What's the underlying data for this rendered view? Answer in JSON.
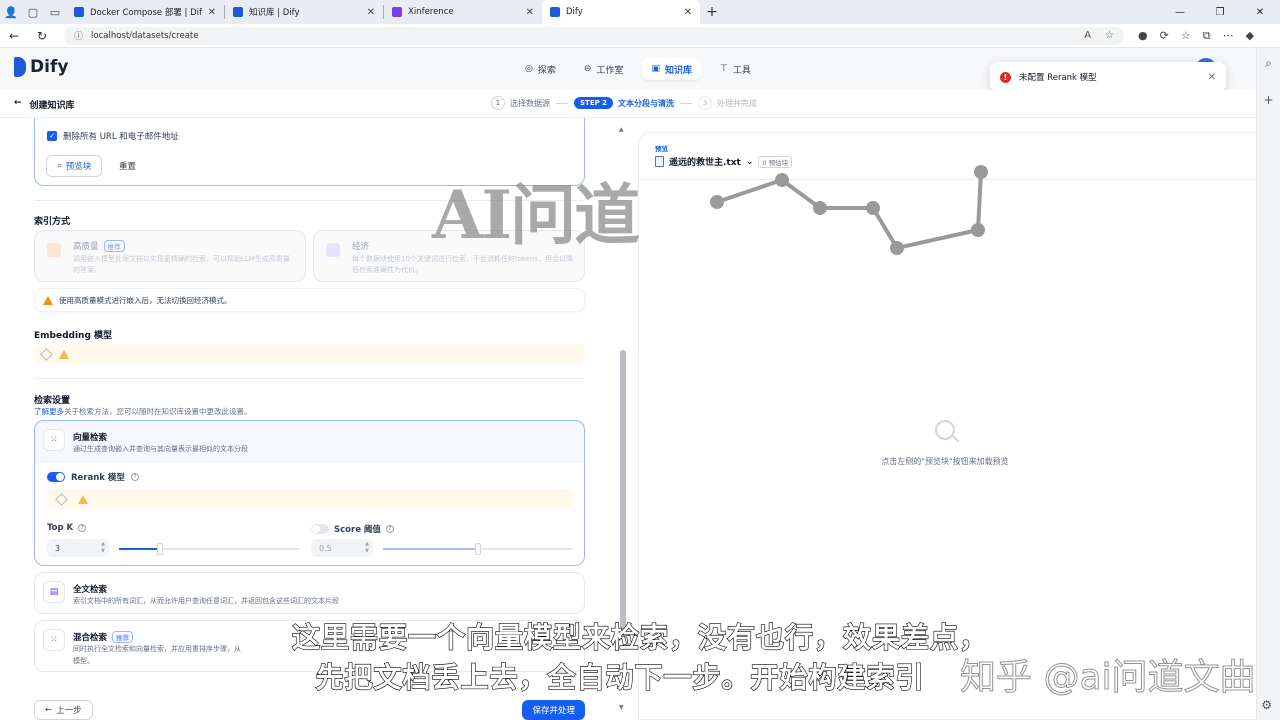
{
  "browser": {
    "tabs": [
      {
        "title": "Docker Compose 部署 | Dify",
        "fav": "#1f5bd8"
      },
      {
        "title": "知识库 | Dify",
        "fav": "#1f5bd8"
      },
      {
        "title": "Xinference",
        "fav": "#7b3fe4"
      },
      {
        "title": "Dify",
        "fav": "#1f5bd8"
      }
    ],
    "url": "localhost/datasets/create"
  },
  "app": {
    "logo": "Dify",
    "nav": [
      {
        "label": "探索",
        "icon": "compass-icon"
      },
      {
        "label": "工作室",
        "icon": "studio-icon"
      },
      {
        "label": "知识库",
        "icon": "book-icon",
        "active": true
      },
      {
        "label": "工具",
        "icon": "tool-icon"
      }
    ]
  },
  "toast": {
    "message": "未配置 Rerank 模型"
  },
  "steps": {
    "back_label": "创建知识库",
    "step1": {
      "num": "1",
      "label": "选择数据源"
    },
    "step2": {
      "pill": "STEP 2",
      "label": "文本分段与清洗"
    },
    "step3": {
      "num": "3",
      "label": "处理并完成"
    }
  },
  "preprocess": {
    "remove_urls_label": "删除所有 URL 和电子邮件地址",
    "preview_button": "预览块",
    "reset_button": "重置"
  },
  "index": {
    "title": "索引方式",
    "high_quality": {
      "title": "高质量",
      "tag": "推荐",
      "desc": "调用嵌入模型处理文档以实现更精确的检索，可以帮助LLM生成高质量的答案。"
    },
    "economy": {
      "title": "经济",
      "desc": "每个数据块使用10个关键词进行检索，不会消耗任何tokens，但会以降低检索准确性为代价。"
    },
    "warning": "使用高质量模式进行嵌入后，无法切换回经济模式。"
  },
  "embedding": {
    "title": "Embedding 模型"
  },
  "retrieval": {
    "title": "检索设置",
    "learn_more": "了解更多",
    "subtitle_rest": "关于检索方法，您可以随时在知识库设置中更改此设置。",
    "vector": {
      "title": "向量检索",
      "desc": "通过生成查询嵌入并查询与其向量表示最相似的文本分段",
      "rerank_label": "Rerank 模型",
      "topk_label": "Top K",
      "topk_value": "3",
      "score_label": "Score 阈值",
      "score_value": "0.5"
    },
    "fulltext": {
      "title": "全文检索",
      "desc": "索引文档中的所有词汇，从而允许用户查询任意词汇，并返回包含这些词汇的文本片段"
    },
    "hybrid": {
      "title": "混合检索",
      "tag": "推荐",
      "desc_line1": "同时执行全文检索和向量检索，并应用重排序步骤，从",
      "desc_line2": "模型。"
    }
  },
  "footer": {
    "prev": "上一步",
    "next": "保存并处理"
  },
  "preview": {
    "label": "预览",
    "file": "遥远的救世主.txt",
    "count": "0 预估块",
    "empty_text": "点击左侧的\"预览块\"按钮来加载预览"
  },
  "overlay": {
    "watermark_logo": "AI问道",
    "subtitle_line1": "这里需要一个向量模型来检索，没有也行，效果差点，",
    "subtitle_line2": "先把文档丢上去，全自动下一步。开始构建索引",
    "watermark_zhihu": "知乎 @ai问道文曲"
  },
  "colors": {
    "primary": "#155eef",
    "warning": "#f79009",
    "error": "#d92d20"
  }
}
